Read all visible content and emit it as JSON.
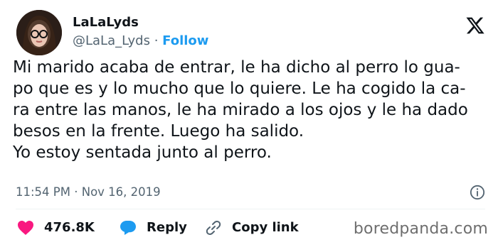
{
  "author": {
    "display_name": "LaLaLyds",
    "handle": "@LaLa_Lyds",
    "separator": "·",
    "follow_label": "Follow"
  },
  "tweet": {
    "lines": [
      "Mi marido acaba de entrar, le ha dicho al perro lo gua-",
      "po que es y lo mucho que lo quiere. Le ha cogido la ca-",
      "ra entre las manos, le ha mirado a los ojos y le ha dado",
      "besos en la frente. Luego ha salido.",
      "Yo estoy sentada junto al perro."
    ],
    "time": "11:54 PM",
    "date": "Nov 16, 2019",
    "meta_separator": "·"
  },
  "actions": {
    "likes_count": "476.8K",
    "reply_label": "Reply",
    "copy_label": "Copy link"
  },
  "watermark": "boredpanda.com",
  "icons": {
    "platform": "x-logo-icon",
    "like": "heart-icon",
    "reply": "speech-bubble-icon",
    "copy": "link-icon",
    "info": "info-icon"
  },
  "colors": {
    "like": "#f91880",
    "reply": "#1d9bf0",
    "follow": "#1d9bf0",
    "muted": "#536471"
  }
}
